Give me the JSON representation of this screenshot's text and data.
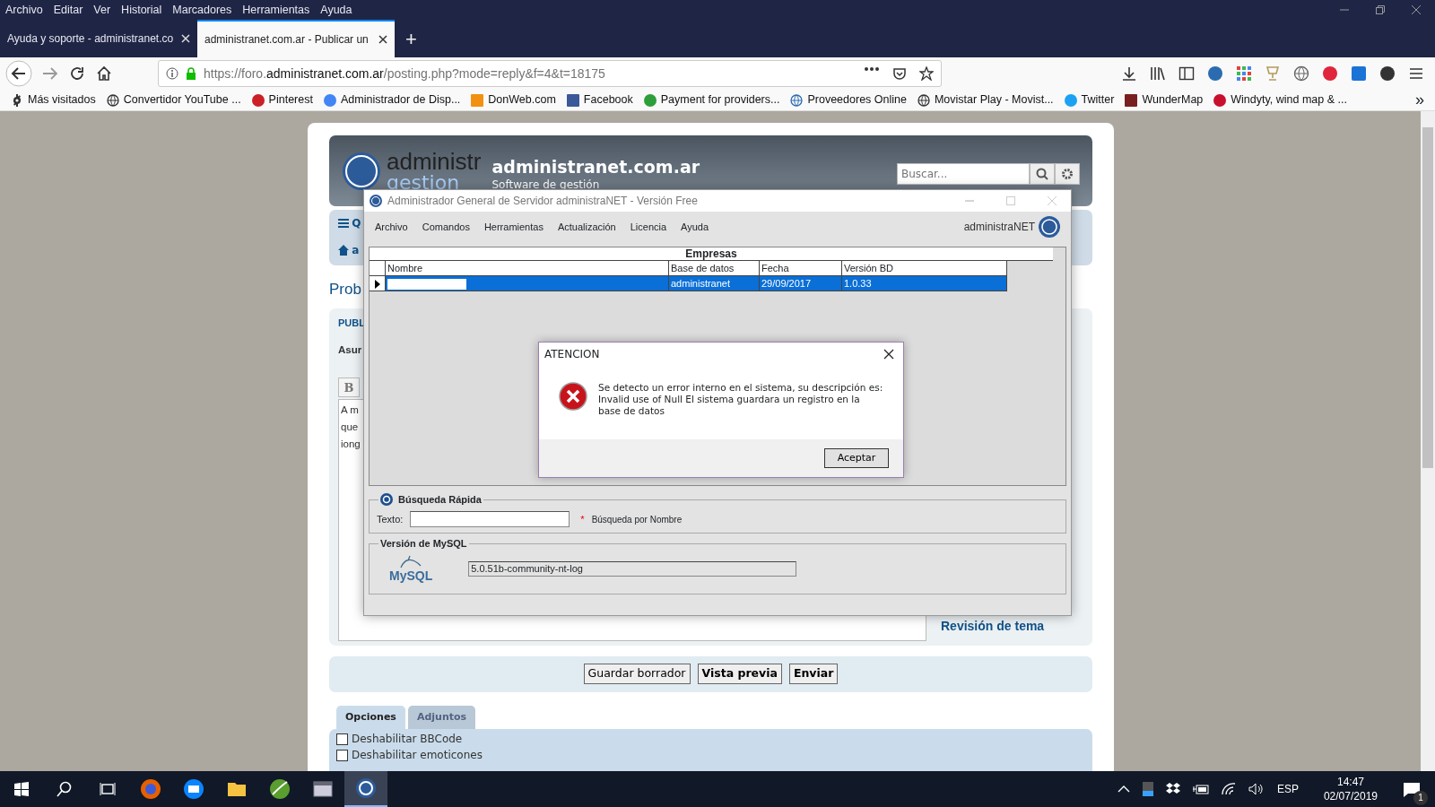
{
  "browser": {
    "menu": [
      "Archivo",
      "Editar",
      "Ver",
      "Historial",
      "Marcadores",
      "Herramientas",
      "Ayuda"
    ],
    "tabs": [
      {
        "label": "Ayuda y soporte - administranet.co",
        "selected": false
      },
      {
        "label": "administranet.com.ar - Publicar un",
        "selected": true
      }
    ],
    "new_tab": "+",
    "url": {
      "prefix": "https://foro.",
      "domain": "administranet.com.ar",
      "path": "/posting.php?mode=reply&f=4&t=18175"
    },
    "bookmarks": [
      {
        "label": "Más visitados",
        "kind": "gear",
        "color": "#333333"
      },
      {
        "label": "Convertidor YouTube ...",
        "kind": "globe",
        "color": "#333333"
      },
      {
        "label": "Pinterest",
        "kind": "circle",
        "color": "#cb2027"
      },
      {
        "label": "Administrador de Disp...",
        "kind": "circle",
        "color": "#4285f4"
      },
      {
        "label": "DonWeb.com",
        "kind": "square",
        "color": "#f29111"
      },
      {
        "label": "Facebook",
        "kind": "square",
        "color": "#3b5998"
      },
      {
        "label": "Payment for providers...",
        "kind": "circle",
        "color": "#2e9e3a"
      },
      {
        "label": "Proveedores Online",
        "kind": "globe",
        "color": "#2b6cb0"
      },
      {
        "label": "Movistar Play - Movist...",
        "kind": "globe",
        "color": "#333333"
      },
      {
        "label": "Twitter",
        "kind": "circle",
        "color": "#1da1f2"
      },
      {
        "label": "WunderMap",
        "kind": "square",
        "color": "#7a1f1f"
      },
      {
        "label": "Windyty, wind map & ...",
        "kind": "circle",
        "color": "#c8102e"
      }
    ],
    "bookmarks_overflow": "»"
  },
  "forum": {
    "logo_text": "administr",
    "logo_sub": "gestion",
    "site_title": "administranet.com.ar",
    "site_subtitle": "Software de gestión",
    "search": {
      "placeholder": "Buscar..."
    },
    "nav_fragment": "Q",
    "breadcrumb_fragment": "a",
    "heading_fragment": "Prob",
    "section_fragment": "PUBL",
    "subject_fragment": "Asur",
    "bold_button": "B",
    "body_fragments": [
      "A m",
      "que",
      "iong"
    ],
    "side_heading": "Revisión de tema",
    "buttons": [
      {
        "label": "Guardar borrador",
        "bold": false
      },
      {
        "label": "Vista previa",
        "bold": true
      },
      {
        "label": "Enviar",
        "bold": true
      }
    ],
    "option_tabs": [
      {
        "label": "Opciones",
        "selected": true
      },
      {
        "label": "Adjuntos",
        "selected": false
      }
    ],
    "options": [
      {
        "label": "Deshabilitar BBCode",
        "checked": false
      },
      {
        "label": "Deshabilitar emoticones",
        "checked": false
      }
    ]
  },
  "app_window": {
    "title": "Administrador General de Servidor administraNET - Versión Free",
    "menu": [
      "Archivo",
      "Comandos",
      "Herramientas",
      "Actualización",
      "Licencia",
      "Ayuda"
    ],
    "brand": "administraNET",
    "grid": {
      "title": "Empresas",
      "columns": [
        "Nombre",
        "Base de datos",
        "Fecha",
        "Versión BD"
      ],
      "rows": [
        {
          "database": "administranet",
          "date": "29/09/2017",
          "version": "1.0.33",
          "selected": true
        }
      ]
    },
    "quick_search": {
      "title": "Búsqueda Rápida",
      "label": "Texto:",
      "hint_mark": "*",
      "hint": "Búsqueda por Nombre"
    },
    "mysql": {
      "title": "Versión de MySQL",
      "logo_text": "MySQL",
      "version": "5.0.51b-community-nt-log"
    }
  },
  "dialog": {
    "title": "ATENCION",
    "message": "Se detecto un error interno en el sistema, su descripción es: Invalid use of Null El sistema guardara un registro en la base de datos",
    "button": "Aceptar"
  },
  "taskbar": {
    "apps": [
      {
        "kind": "firefox",
        "selected": false
      },
      {
        "kind": "mail",
        "selected": false
      },
      {
        "kind": "folder",
        "selected": false
      },
      {
        "kind": "ball",
        "selected": false
      },
      {
        "kind": "window",
        "selected": false
      },
      {
        "kind": "app",
        "selected": true
      }
    ],
    "language": "ESP",
    "time": "14:47",
    "date": "02/07/2019",
    "notifications": "1"
  }
}
